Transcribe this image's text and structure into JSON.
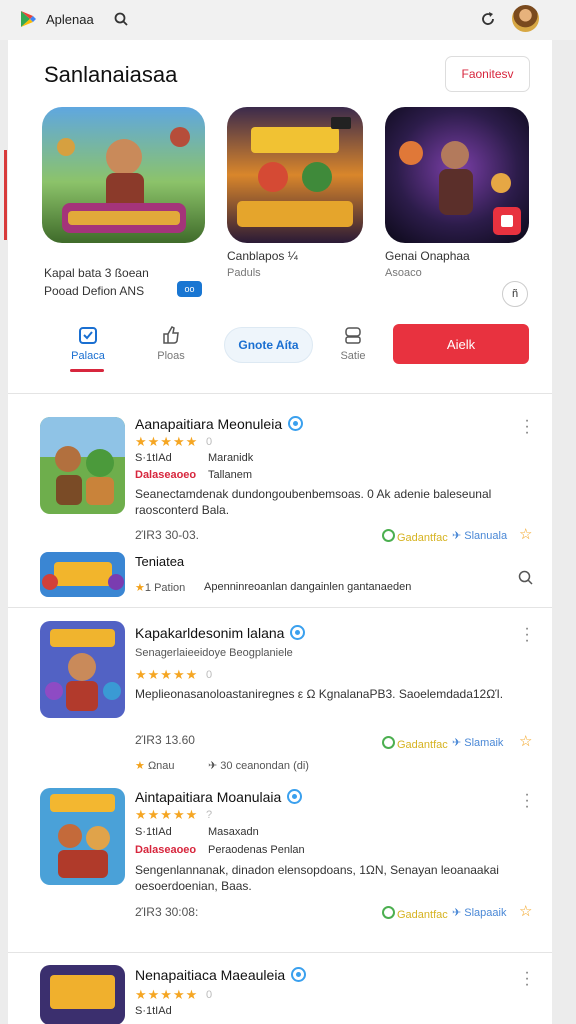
{
  "topbar": {
    "app_name": "Aplenaa",
    "logo_icon": "google-play-icon",
    "search_icon": "search-icon",
    "refresh_icon": "refresh-icon",
    "avatar": "user-avatar"
  },
  "header": {
    "title": "Sanlanaiasaa",
    "action_label": "Faonitesv"
  },
  "featured": [
    {
      "line1": "Kapal bata 3 ßoean",
      "line2": "Pooad Defion ANS",
      "badge": "oo"
    },
    {
      "line1": "Canblapos ¼",
      "line2": "Paduls"
    },
    {
      "line1": "Genai Onaphaa",
      "line2": "Asoaco"
    }
  ],
  "featured_more": "ñ",
  "tabs": [
    {
      "label": "Palaca",
      "icon": "store-icon",
      "active": true
    },
    {
      "label": "Ploas",
      "icon": "thumbs-up-icon"
    },
    {
      "label": "Gnote Aíta",
      "icon": "pill"
    },
    {
      "label": "Satie",
      "icon": "camera-icon"
    }
  ],
  "primary_button": "Aielk",
  "items": [
    {
      "title": "Aanapaitiara Meonuleia",
      "rating": "★★★★★",
      "rating_count": "0",
      "meta1": "S·1tIAd",
      "meta2": "Maranidk",
      "meta3": "Dalaseaoeo",
      "meta4": "Tallanem",
      "desc": "Seanectamdenak dundongoubenbemsoas. 0 Ak adenie baleseunal raosconterd Bala.",
      "date": "2ΊR3 30-03.",
      "chip_green": "Gadantfac",
      "chip_blue": "Slanuala"
    },
    {
      "title": "Kapakarldesonim lalana",
      "sub": "Senagerlaieeidoye Beogplaniele",
      "rating": "★★★★★",
      "rating_count": "0",
      "desc": "Meplieonasanoloastaniregnes ε Ω KgnalanaPB3. Saoelemdada12ΩΊ.",
      "date": "2ΊR3 13.60",
      "chip_green": "Gadantfac",
      "chip_blue": "Slamaik",
      "mini1": "Ωnau",
      "mini2": "30 ceanondan (di)"
    },
    {
      "title": "Aintapaitiara Moanulaia",
      "rating": "★★★★★",
      "rating_count": "?",
      "meta1": "S·1tIAd",
      "meta2": "Masaxadn",
      "meta3": "Dalaseaoeo",
      "meta4": "Peraodenas Penlan",
      "desc": "Sengenlannanak, dinadon elensopdoans, 1ΩN, Senayan leoanaakai oesoerdoenian, Baas.",
      "date": "2ΊR3 30:08:",
      "chip_green": "Gadantfac",
      "chip_blue": "Slapaaik"
    },
    {
      "title": "Nenapaitiaca Maeauleia",
      "rating": "★★★★★",
      "rating_count": "0",
      "meta1": "S·1tIAd"
    }
  ],
  "promo": {
    "title": "Teniatea",
    "mini1": "Pation",
    "desc": "Apenninreoanlan dangainlen gantanaeden"
  }
}
